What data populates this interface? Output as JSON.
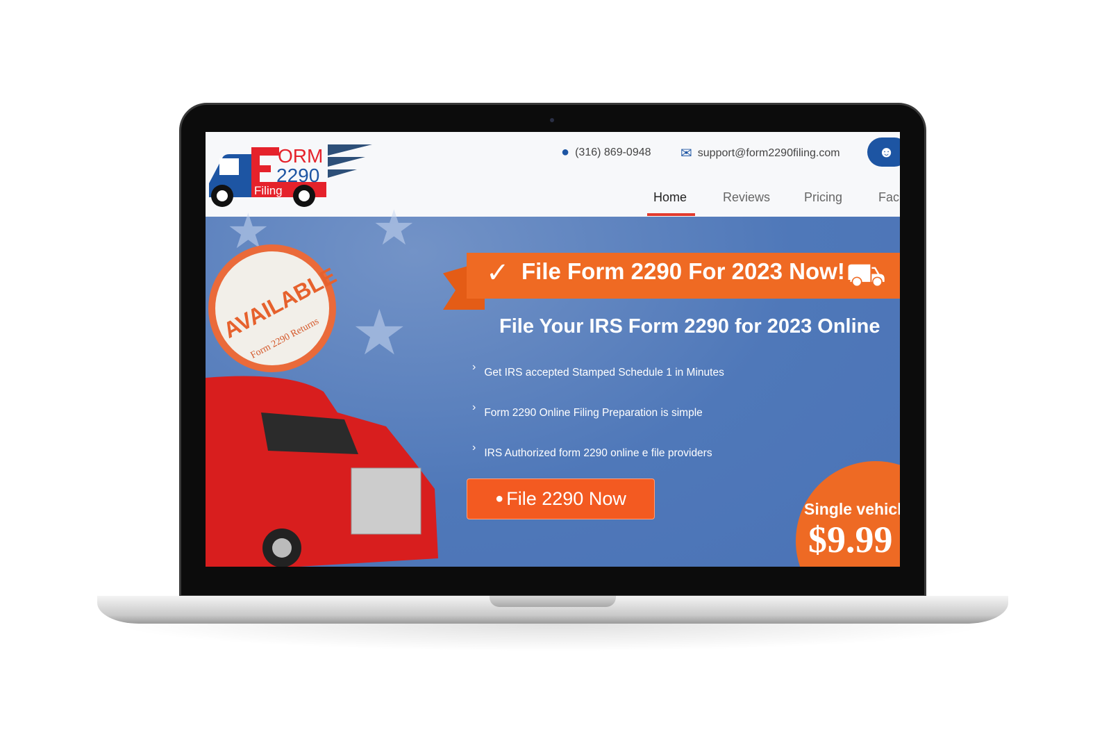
{
  "header": {
    "logo_text": {
      "line1": "ORM",
      "letter": "F",
      "line2": "2290",
      "line3": "Filing"
    },
    "phone": "(316) 869-0948",
    "email": "support@form2290filing.com",
    "nav": [
      {
        "label": "Home",
        "active": true
      },
      {
        "label": "Reviews"
      },
      {
        "label": "Pricing"
      },
      {
        "label": "Fac"
      }
    ]
  },
  "hero": {
    "ribbon_title": "File Form 2290 For 2023 Now!",
    "subtitle": "File Your IRS Form 2290 for 2023 Online",
    "bullets": [
      "Get IRS accepted Stamped Schedule 1 in Minutes",
      "Form 2290 Online Filing Preparation is simple",
      "IRS Authorized form 2290 online e file providers"
    ],
    "cta_label": "File 2290 Now",
    "stamp": {
      "main": "AVAILABLE",
      "sub": "Form 2290 Returns"
    },
    "price_badge": {
      "label": "Single vehicl",
      "price": "$9.99"
    }
  },
  "colors": {
    "accent": "#ef6a23",
    "hero_bg": "#4f78b9",
    "brand_blue": "#1d55a3",
    "brand_red": "#e5222b"
  }
}
